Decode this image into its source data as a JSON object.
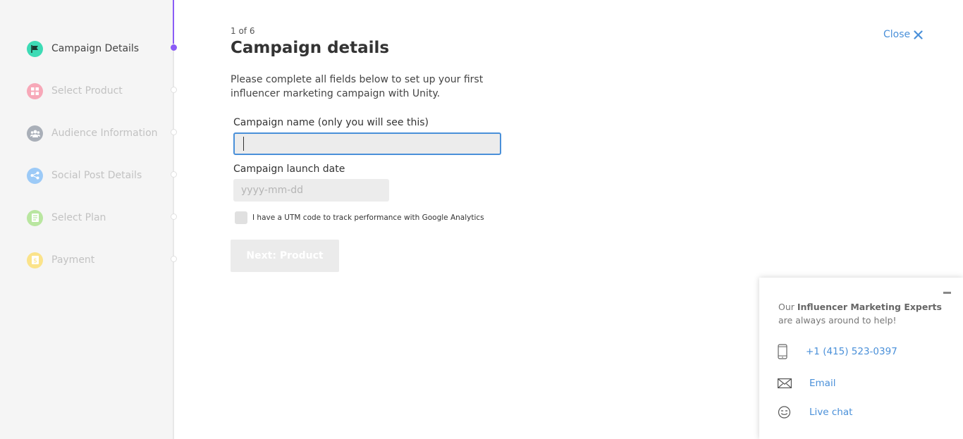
{
  "sidebar": {
    "steps": [
      {
        "label": "Campaign Details",
        "icon": "flag-icon",
        "color": "#3ddbb5",
        "active": true
      },
      {
        "label": "Select Product",
        "icon": "grid-icon",
        "color": "#f7a8b8",
        "active": false
      },
      {
        "label": "Audience Information",
        "icon": "people-icon",
        "color": "#a9afb8",
        "active": false
      },
      {
        "label": "Social Post Details",
        "icon": "share-icon",
        "color": "#9ccaf7",
        "active": false
      },
      {
        "label": "Select Plan",
        "icon": "document-icon",
        "color": "#b9e6a0",
        "active": false
      },
      {
        "label": "Payment",
        "icon": "coin-icon",
        "color": "#fbe38a",
        "active": false
      }
    ],
    "accent": "#8b5cf6"
  },
  "form": {
    "counter": "1 of 6",
    "title": "Campaign details",
    "intro": "Please complete all fields below to set up your first influencer marketing campaign with Unity.",
    "name_label": "Campaign name (only you will see this)",
    "name_value": "",
    "date_label": "Campaign launch date",
    "date_placeholder": "yyyy-mm-dd",
    "utm_label": "I have a UTM code to track performance with Google Analytics",
    "next_label": "Next: Product"
  },
  "close": {
    "label": "Close"
  },
  "help": {
    "line1_pre": "Our ",
    "line1_bold": "Influencer Marketing Experts",
    "line2": "are always around to help!",
    "phone": "+1 (415) 523-0397",
    "email": "Email",
    "chat": "Live chat",
    "link_color": "#4a90d9"
  }
}
